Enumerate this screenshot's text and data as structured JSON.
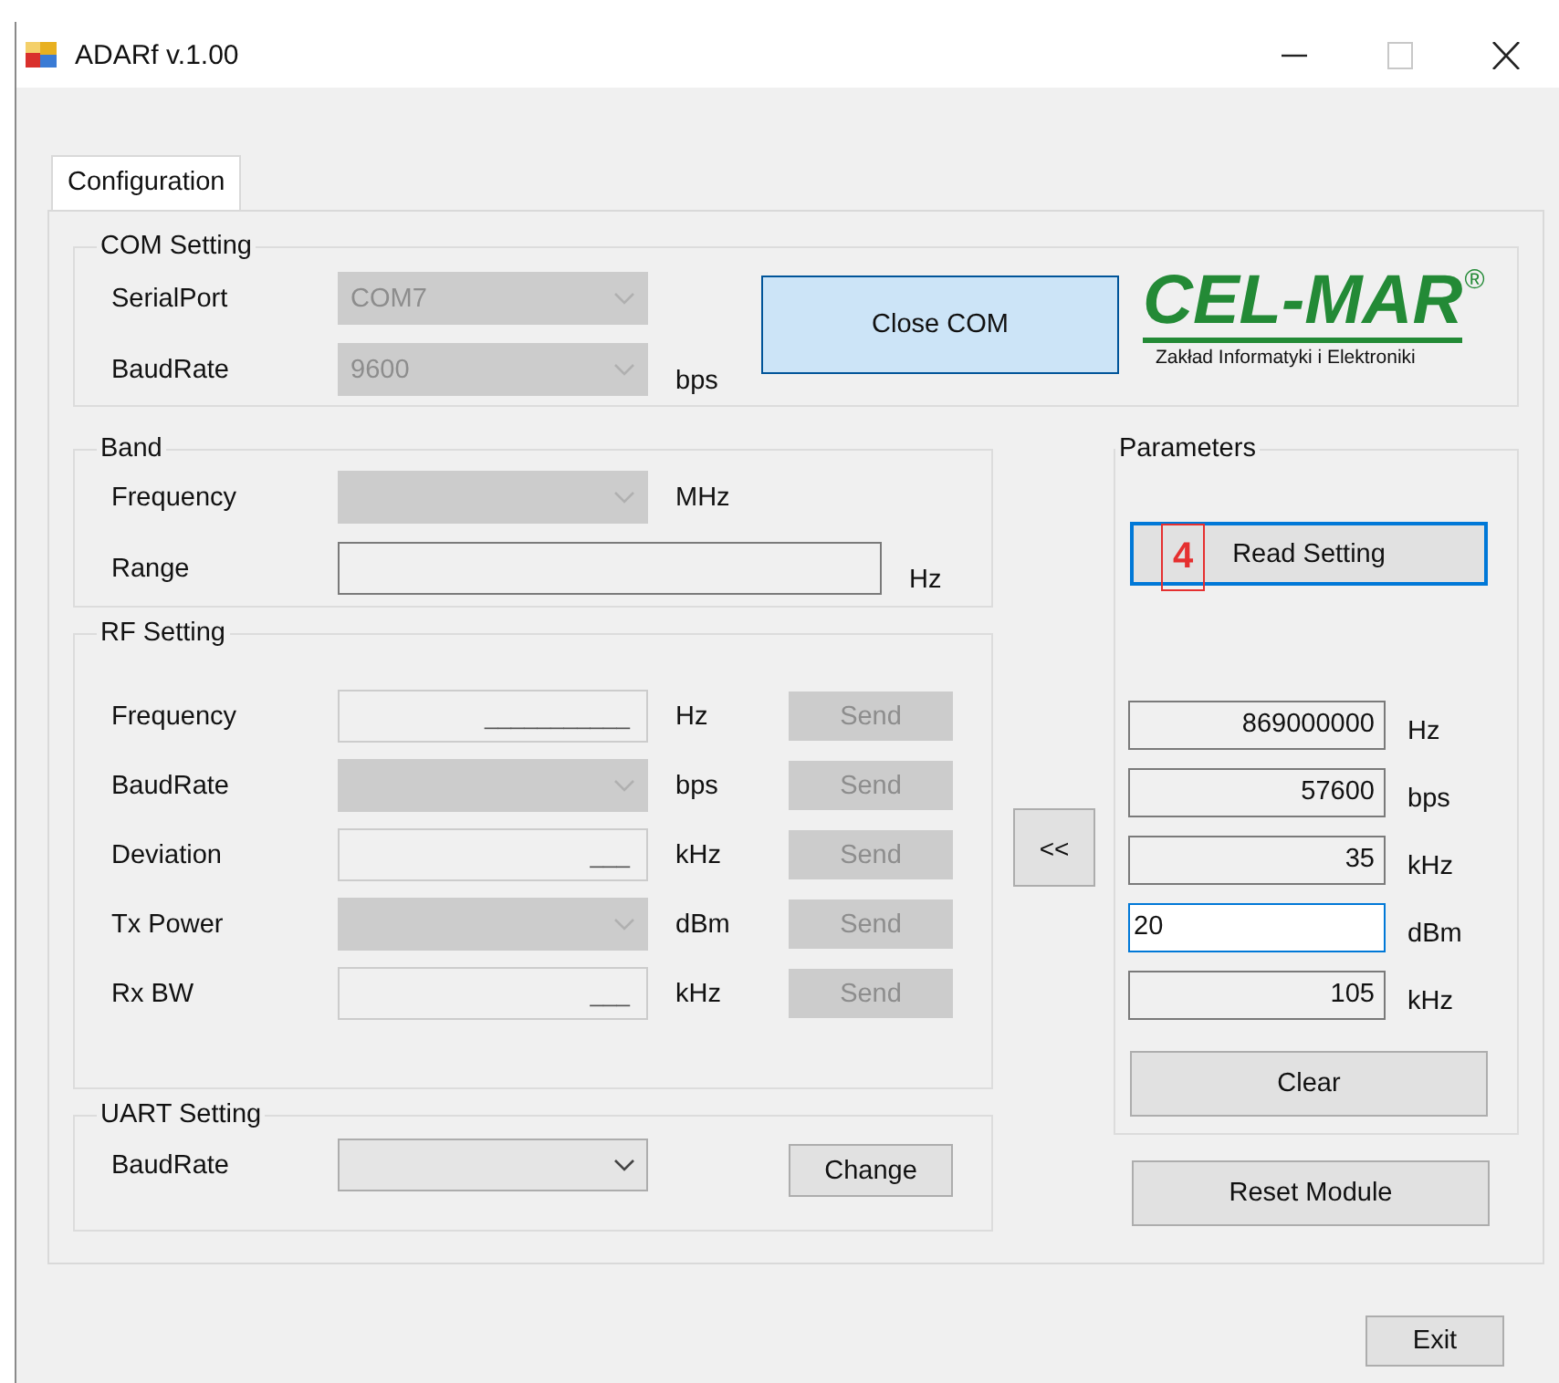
{
  "window": {
    "title": "ADARf v.1.00",
    "controls": [
      {
        "kind": "minimize",
        "disabled": false
      },
      {
        "kind": "maximize",
        "disabled": true
      },
      {
        "kind": "close",
        "disabled": false
      }
    ]
  },
  "tabs": [
    {
      "label": "Configuration",
      "selected": true
    }
  ],
  "com_setting": {
    "title": "COM Setting",
    "rows": [
      {
        "label": "SerialPort",
        "value": "COM7",
        "disabled": true
      },
      {
        "label": "BaudRate",
        "value": "9600",
        "unit": "bps",
        "disabled": true
      }
    ],
    "button": {
      "label": "Close COM",
      "highlighted": true
    }
  },
  "logo": {
    "name": "CEL-MAR",
    "mark": "®",
    "tagline": "Zakład Informatyki i Elektroniki"
  },
  "band": {
    "title": "Band",
    "rows": [
      {
        "kind": "combo",
        "label": "Frequency",
        "unit": "MHz",
        "disabled": true
      },
      {
        "kind": "text",
        "label": "Range",
        "unit": "Hz",
        "disabled": false
      }
    ]
  },
  "rf_setting": {
    "title": "RF Setting",
    "rows": [
      {
        "kind": "masked",
        "label": "Frequency",
        "mask": "___________",
        "unit": "Hz",
        "button": "Send",
        "disabled": true
      },
      {
        "kind": "combo",
        "label": "BaudRate",
        "unit": "bps",
        "button": "Send",
        "disabled": true
      },
      {
        "kind": "masked",
        "label": "Deviation",
        "mask": "___",
        "unit": "kHz",
        "button": "Send",
        "disabled": true
      },
      {
        "kind": "combo",
        "label": "Tx Power",
        "unit": "dBm",
        "button": "Send",
        "disabled": true
      },
      {
        "kind": "masked",
        "label": "Rx BW",
        "mask": "___",
        "unit": "kHz",
        "button": "Send",
        "disabled": true
      }
    ]
  },
  "uart_setting": {
    "title": "UART Setting",
    "label": "BaudRate",
    "disabled": false,
    "button": "Change"
  },
  "copy_button": "<<",
  "parameters": {
    "title": "Parameters",
    "read_button": {
      "label": "Read Setting",
      "focused": true
    },
    "values": [
      {
        "value": "869000000",
        "unit": "Hz",
        "focused": false
      },
      {
        "value": "57600",
        "unit": "bps",
        "focused": false
      },
      {
        "value": "35",
        "unit": "kHz",
        "focused": false
      },
      {
        "value": "20",
        "unit": "dBm",
        "focused": true
      },
      {
        "value": "105",
        "unit": "kHz",
        "focused": false
      }
    ],
    "clear_button": "Clear"
  },
  "reset_button": "Reset Module",
  "exit_button": "Exit",
  "callout": "4"
}
